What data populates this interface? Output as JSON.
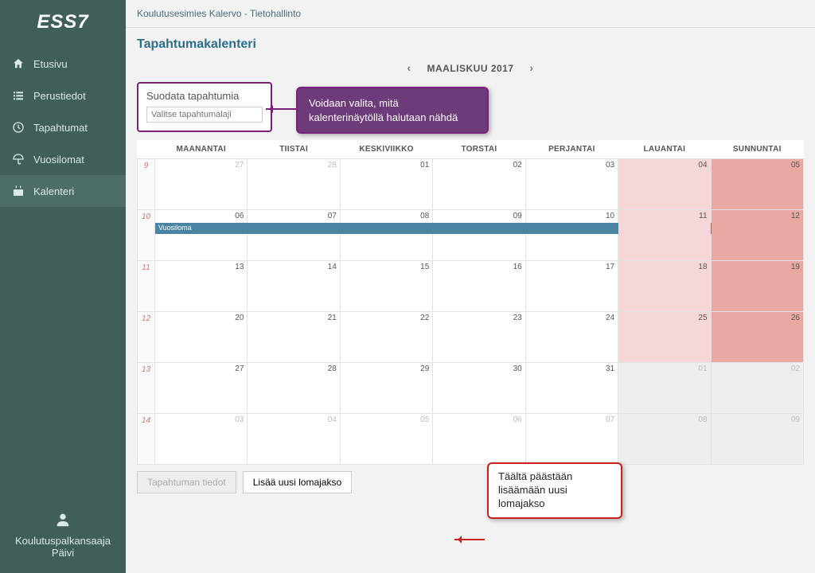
{
  "app": {
    "name": "ESS7"
  },
  "sidebar": {
    "items": [
      {
        "label": "Etusivu",
        "icon": "home"
      },
      {
        "label": "Perustiedot",
        "icon": "list"
      },
      {
        "label": "Tapahtumat",
        "icon": "clock"
      },
      {
        "label": "Vuosilomat",
        "icon": "umbrella"
      },
      {
        "label": "Kalenteri",
        "icon": "calendar"
      }
    ]
  },
  "user": {
    "line1": "Koulutuspalkansaaja",
    "line2": "Päivi"
  },
  "breadcrumb": "Koulutusesimies Kalervo - Tietohallinto",
  "page_title": "Tapahtumakalenteri",
  "month_label": "MAALISKUU 2017",
  "filter": {
    "title": "Suodata tapahtumia",
    "placeholder": "Valitse tapahtumalaji"
  },
  "callouts": {
    "filter_note": "Voidaan valita, mitä kalenterinäytöllä halutaan nähdä",
    "add_note": "Täältä päästään lisäämään uusi lomajakso"
  },
  "weekdays": [
    "MAANANTAI",
    "TIISTAI",
    "KESKIVIIKKO",
    "TORSTAI",
    "PERJANTAI",
    "LAUANTAI",
    "SUNNUNTAI"
  ],
  "weeks": [
    {
      "wk": "9",
      "days": [
        {
          "n": "27",
          "other": true
        },
        {
          "n": "28",
          "other": true
        },
        {
          "n": "01"
        },
        {
          "n": "02"
        },
        {
          "n": "03"
        },
        {
          "n": "04",
          "sat": true
        },
        {
          "n": "05",
          "sun": true
        }
      ]
    },
    {
      "wk": "10",
      "days": [
        {
          "n": "06"
        },
        {
          "n": "07"
        },
        {
          "n": "08"
        },
        {
          "n": "09"
        },
        {
          "n": "10"
        },
        {
          "n": "11",
          "sat": true
        },
        {
          "n": "12",
          "sun": true
        }
      ],
      "event": "Vuosiloma"
    },
    {
      "wk": "11",
      "days": [
        {
          "n": "13"
        },
        {
          "n": "14"
        },
        {
          "n": "15"
        },
        {
          "n": "16"
        },
        {
          "n": "17"
        },
        {
          "n": "18",
          "sat": true
        },
        {
          "n": "19",
          "sun": true
        }
      ]
    },
    {
      "wk": "12",
      "days": [
        {
          "n": "20"
        },
        {
          "n": "21"
        },
        {
          "n": "22"
        },
        {
          "n": "23"
        },
        {
          "n": "24"
        },
        {
          "n": "25",
          "sat": true
        },
        {
          "n": "26",
          "sun": true
        }
      ]
    },
    {
      "wk": "13",
      "days": [
        {
          "n": "27"
        },
        {
          "n": "28"
        },
        {
          "n": "29"
        },
        {
          "n": "30"
        },
        {
          "n": "31"
        },
        {
          "n": "01",
          "other": true,
          "sat": true
        },
        {
          "n": "02",
          "other": true,
          "sun": true
        }
      ]
    },
    {
      "wk": "14",
      "days": [
        {
          "n": "03",
          "other": true
        },
        {
          "n": "04",
          "other": true
        },
        {
          "n": "05",
          "other": true
        },
        {
          "n": "06",
          "other": true
        },
        {
          "n": "07",
          "other": true
        },
        {
          "n": "08",
          "other": true,
          "sat": true
        },
        {
          "n": "09",
          "other": true,
          "sun": true
        }
      ]
    }
  ],
  "buttons": {
    "details": "Tapahtuman tiedot",
    "add_period": "Lisää uusi lomajakso"
  }
}
